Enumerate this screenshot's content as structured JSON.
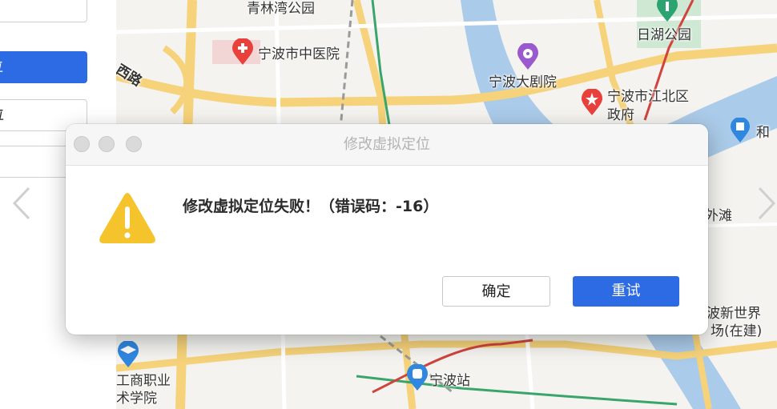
{
  "side_panel": {
    "box_top_label": "",
    "primary_button_label": "位",
    "secondary_box_label": "位",
    "box_bottom_label": ""
  },
  "map": {
    "labels": {
      "qinglinwan_park": "青林湾公园",
      "ningbo_tcm_hospital": "宁波市中医院",
      "xi_road": "西路",
      "ningbo_grand_theatre": "宁波大剧院",
      "jiangbei_gov_line1": "宁波市江北区",
      "jiangbei_gov_line2": "政府",
      "rihu_park": "日湖公园",
      "he_partial": "和",
      "waitan": "外滩",
      "new_world_line1": "波新世界",
      "new_world_line2": "场(在建)",
      "gongshang_line1": "工商职业",
      "gongshang_line2": "术学院",
      "ningbo_station": "宁波站"
    }
  },
  "dialog": {
    "title": "修改虚拟定位",
    "message": "修改虚拟定位失败！（错误码：-16）",
    "ok_label": "确定",
    "retry_label": "重试"
  },
  "colors": {
    "primary": "#2d6be4",
    "warning": "#f5c32c",
    "poi_red": "#e8413c",
    "poi_purple": "#9b59d0",
    "poi_blue": "#2f87e0",
    "poi_green": "#2ba471"
  },
  "icons": {
    "warning": "warning-triangle-icon",
    "prev": "chevron-left-icon",
    "next": "chevron-right-icon"
  }
}
